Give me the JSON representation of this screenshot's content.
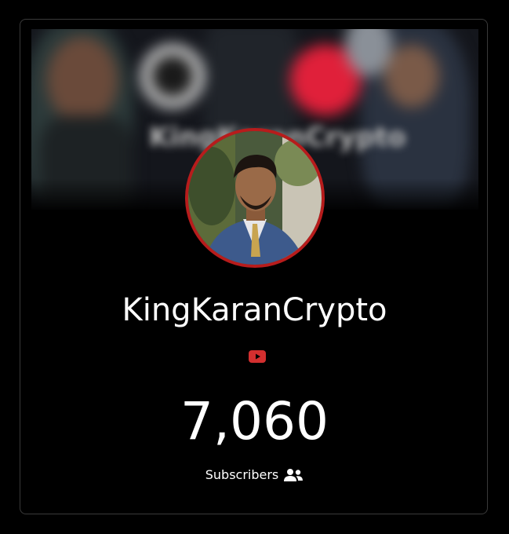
{
  "channel": {
    "name": "KingKaranCrypto",
    "platform_icon": "youtube-icon",
    "subscriber_count": "7,060",
    "subscribers_label": "Subscribers",
    "subscribers_icon": "users-icon"
  },
  "banner": {
    "text": "KingKaranCrypto"
  },
  "colors": {
    "background": "#000000",
    "card_border": "#3a3a3a",
    "avatar_ring": "#b71c1c",
    "youtube_red": "#d32f2f",
    "text": "#ffffff"
  }
}
